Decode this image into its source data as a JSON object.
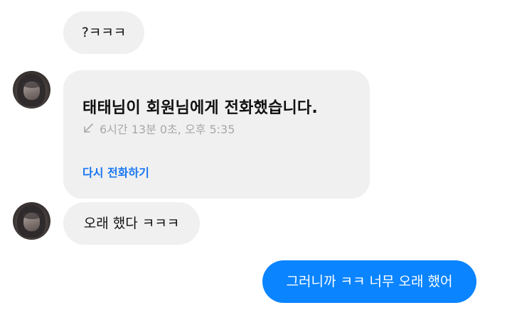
{
  "messages": {
    "incoming_1": "?ㅋㅋㅋ",
    "call_card": {
      "title": "태태님이 회원님에게 전화했습니다.",
      "meta": "6시간 13분 0초, 오후 5:35",
      "meta_icon": "call-arrow-icon",
      "callback_label": "다시 전화하기"
    },
    "incoming_2": "오래 했다 ㅋㅋㅋ",
    "outgoing_1": "그러니까 ㅋㅋ 너무 오래 했어"
  },
  "colors": {
    "incoming_bubble": "#f0f0f0",
    "outgoing_bubble": "#0a84ff",
    "link": "#1877f2",
    "meta_text": "#a8a8a8"
  }
}
